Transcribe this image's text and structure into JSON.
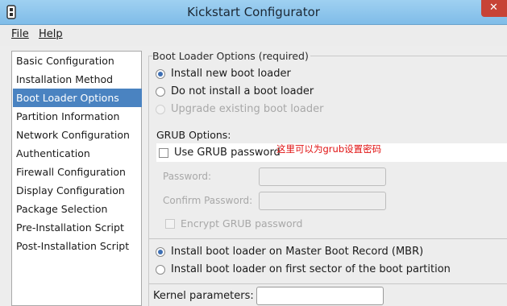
{
  "window": {
    "title": "Kickstart Configurator",
    "close_glyph": "✕"
  },
  "menu": {
    "items": [
      {
        "label": "File"
      },
      {
        "label": "Help"
      }
    ]
  },
  "sidebar": {
    "items": [
      {
        "label": "Basic Configuration"
      },
      {
        "label": "Installation Method"
      },
      {
        "label": "Boot Loader Options"
      },
      {
        "label": "Partition Information"
      },
      {
        "label": "Network Configuration"
      },
      {
        "label": "Authentication"
      },
      {
        "label": "Firewall Configuration"
      },
      {
        "label": "Display Configuration"
      },
      {
        "label": "Package Selection"
      },
      {
        "label": "Pre-Installation Script"
      },
      {
        "label": "Post-Installation Script"
      }
    ],
    "selected": "Boot Loader Options"
  },
  "main": {
    "group_title": "Boot Loader Options (required)",
    "install_new": "Install new boot loader",
    "do_not_install": "Do not install a boot loader",
    "upgrade": "Upgrade existing boot loader",
    "grub_options_label": "GRUB Options:",
    "use_grub_password": "Use GRUB password",
    "annotation": "这里可以为grub设置密码",
    "password_label": "Password:",
    "confirm_password_label": "Confirm Password:",
    "encrypt_grub_password": "Encrypt GRUB password",
    "install_mbr": "Install boot loader on Master Boot Record (MBR)",
    "install_first_sector": "Install boot loader on first sector of the boot partition",
    "kernel_parameters_label": "Kernel parameters:",
    "kernel_parameters_value": "",
    "password_value": "",
    "confirm_password_value": ""
  },
  "colors": {
    "titlebar": "#9fd0f1",
    "selection": "#4a83c1",
    "annotation": "#e01010",
    "close_button": "#c74336"
  },
  "icons": {
    "app": "app-icon",
    "close": "close-icon"
  }
}
